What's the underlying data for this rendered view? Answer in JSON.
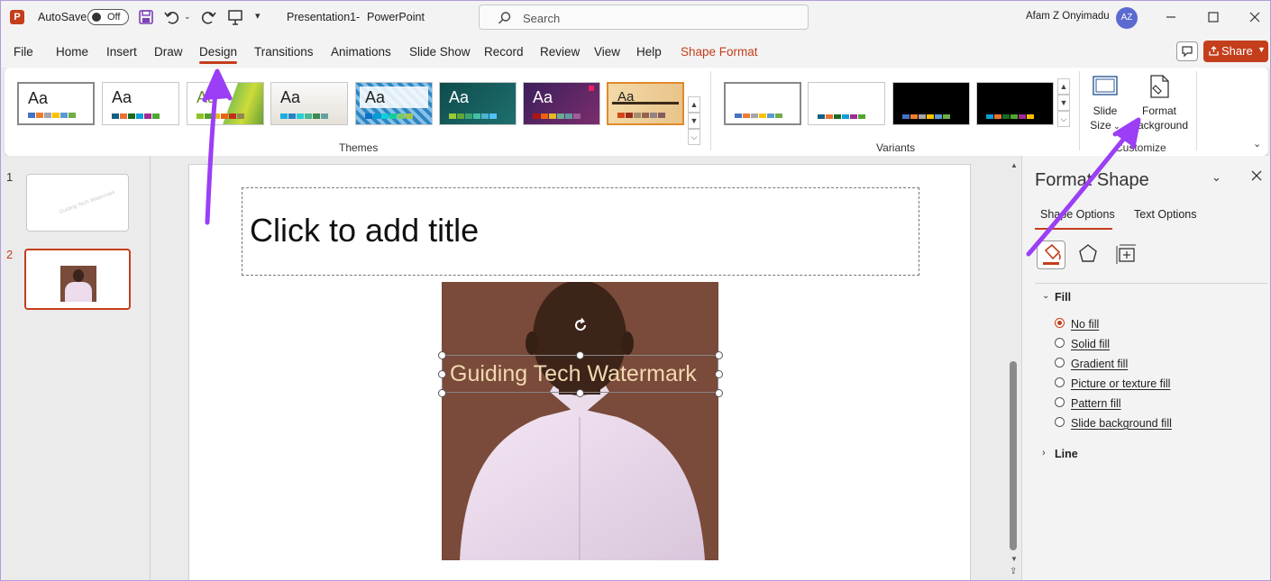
{
  "titlebar": {
    "app_icon": "powerpoint-logo",
    "autosave_label": "AutoSave",
    "autosave_state": "Off",
    "doc_title": "Presentation1",
    "separator": "-",
    "app_name": "PowerPoint",
    "search_placeholder": "Search",
    "user_name": "Afam Z Onyimadu",
    "user_initials": "AZ"
  },
  "menu": {
    "tabs": [
      "File",
      "Home",
      "Insert",
      "Draw",
      "Design",
      "Transitions",
      "Animations",
      "Slide Show",
      "Record",
      "Review",
      "View",
      "Help",
      "Shape Format"
    ],
    "active_tab": "Design",
    "share_label": "Share"
  },
  "ribbon": {
    "theme_sample": "Aa",
    "themes_label": "Themes",
    "variants_label": "Variants",
    "slide_size_line1": "Slide",
    "slide_size_line2": "Size",
    "format_bg_line1": "Format",
    "format_bg_line2": "Background",
    "customize_label": "Customize"
  },
  "slides": {
    "numbers": [
      "1",
      "2"
    ],
    "selected": "2",
    "thumb1_text": "Guiding Tech Watermark"
  },
  "slide": {
    "title_placeholder": "Click to add title",
    "watermark_text": "Guiding Tech Watermark"
  },
  "format_pane": {
    "title": "Format Shape",
    "tab_shape": "Shape Options",
    "tab_text": "Text Options",
    "fill_header": "Fill",
    "fill_options": [
      "No fill",
      "Solid fill",
      "Gradient fill",
      "Picture or texture fill",
      "Pattern fill",
      "Slide background fill"
    ],
    "fill_selected": "No fill",
    "line_header": "Line"
  },
  "colors": {
    "accent": "#c43e1c",
    "annotation_arrow": "#9b3ef5"
  }
}
